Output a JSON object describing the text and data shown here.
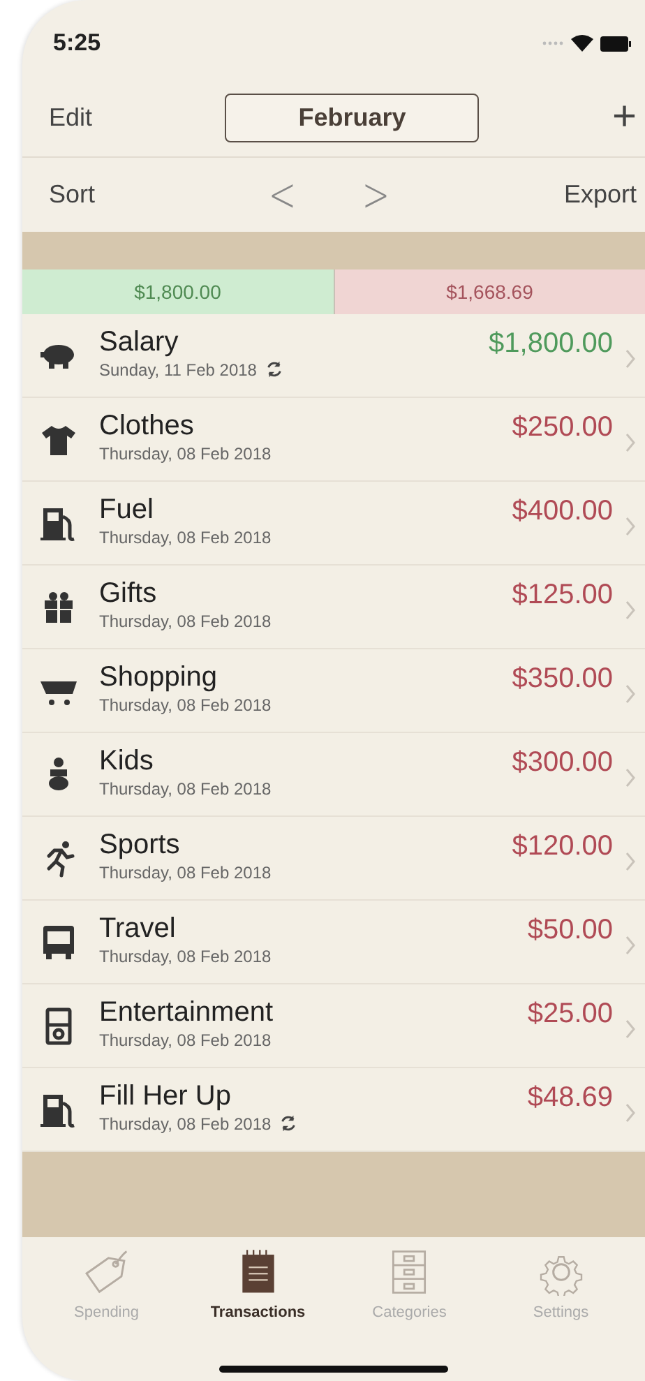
{
  "status_bar": {
    "time": "5:25"
  },
  "nav": {
    "edit": "Edit",
    "month": "February",
    "add": "+"
  },
  "toolbar": {
    "sort": "Sort",
    "prev": "<",
    "next": ">",
    "export": "Export"
  },
  "summary": {
    "income": "$1,800.00",
    "expenses": "$1,668.69"
  },
  "transactions": [
    {
      "name": "Salary",
      "date": "Sunday, 11 Feb 2018",
      "amount": "$1,800.00",
      "kind": "income",
      "recurring": true
    },
    {
      "name": "Clothes",
      "date": "Thursday, 08 Feb 2018",
      "amount": "$250.00",
      "kind": "expense",
      "recurring": false
    },
    {
      "name": "Fuel",
      "date": "Thursday, 08 Feb 2018",
      "amount": "$400.00",
      "kind": "expense",
      "recurring": false
    },
    {
      "name": "Gifts",
      "date": "Thursday, 08 Feb 2018",
      "amount": "$125.00",
      "kind": "expense",
      "recurring": false
    },
    {
      "name": "Shopping",
      "date": "Thursday, 08 Feb 2018",
      "amount": "$350.00",
      "kind": "expense",
      "recurring": false
    },
    {
      "name": "Kids",
      "date": "Thursday, 08 Feb 2018",
      "amount": "$300.00",
      "kind": "expense",
      "recurring": false
    },
    {
      "name": "Sports",
      "date": "Thursday, 08 Feb 2018",
      "amount": "$120.00",
      "kind": "expense",
      "recurring": false
    },
    {
      "name": "Travel",
      "date": "Thursday, 08 Feb 2018",
      "amount": "$50.00",
      "kind": "expense",
      "recurring": false
    },
    {
      "name": "Entertainment",
      "date": "Thursday, 08 Feb 2018",
      "amount": "$25.00",
      "kind": "expense",
      "recurring": false
    },
    {
      "name": "Fill Her Up",
      "date": "Thursday, 08 Feb 2018",
      "amount": "$48.69",
      "kind": "expense",
      "recurring": true
    }
  ],
  "tabs": [
    {
      "label": "Spending",
      "selected": false
    },
    {
      "label": "Transactions",
      "selected": true
    },
    {
      "label": "Categories",
      "selected": false
    },
    {
      "label": "Settings",
      "selected": false
    }
  ]
}
